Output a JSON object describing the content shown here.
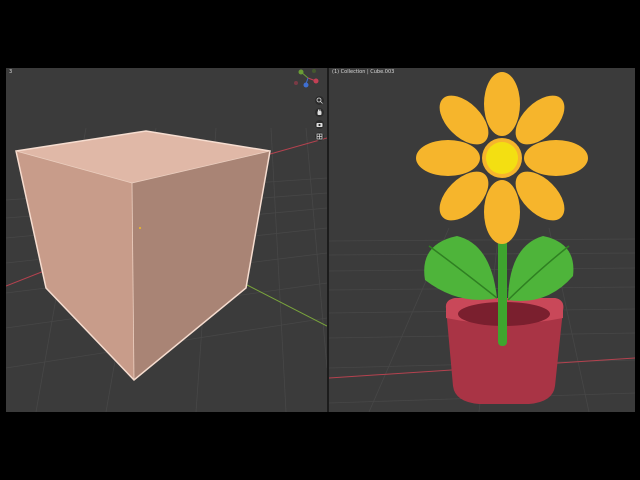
{
  "left_viewport": {
    "header_text": "3",
    "object": "cube",
    "navigation_icons": [
      "zoom-icon",
      "hand-pan-icon",
      "camera-icon",
      "grid-icon"
    ]
  },
  "right_viewport": {
    "header_text": "(1) Collection | Cube.003",
    "object": "flower-in-pot"
  },
  "colors": {
    "viewport_bg": "#3b3b3b",
    "grid_line": "#464646",
    "x_axis": "#b5424f",
    "y_axis": "#7aa53c",
    "cube_face": "#d6ab9a",
    "petal": "#f6b52c",
    "flower_center": "#f3df12",
    "leaf": "#4eb43a",
    "pot": "#a93445"
  }
}
